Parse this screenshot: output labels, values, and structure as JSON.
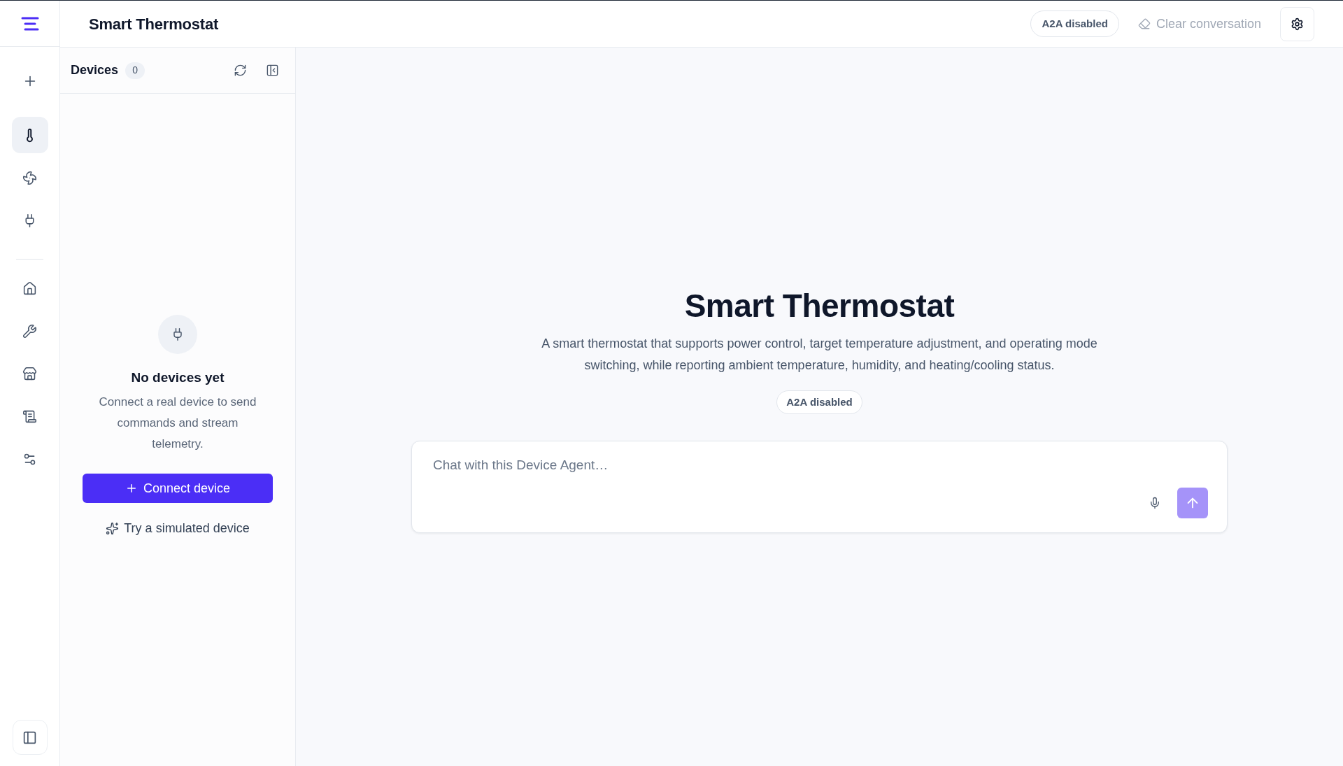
{
  "header": {
    "title": "Smart Thermostat",
    "a2a_badge": "A2A disabled",
    "clear_conversation": {
      "label": "Clear conversation",
      "disabled": true
    }
  },
  "rail": {
    "agents": [
      {
        "selected": true
      },
      {
        "selected": false
      },
      {
        "selected": false
      }
    ]
  },
  "devices_panel": {
    "title": "Devices",
    "count": "0",
    "empty_state": {
      "title": "No devices yet",
      "description": "Connect a real device to send commands and stream telemetry.",
      "connect_button": "Connect device",
      "simulate_link": "Try a simulated device"
    }
  },
  "main": {
    "title": "Smart Thermostat",
    "description": "A smart thermostat that supports power control, target temperature adjustment, and operating mode switching, while reporting ambient temperature, humidity, and heating/cooling status.",
    "badge": "A2A disabled",
    "chat": {
      "placeholder": "Chat with this Device Agent…",
      "send_disabled": true
    }
  }
}
